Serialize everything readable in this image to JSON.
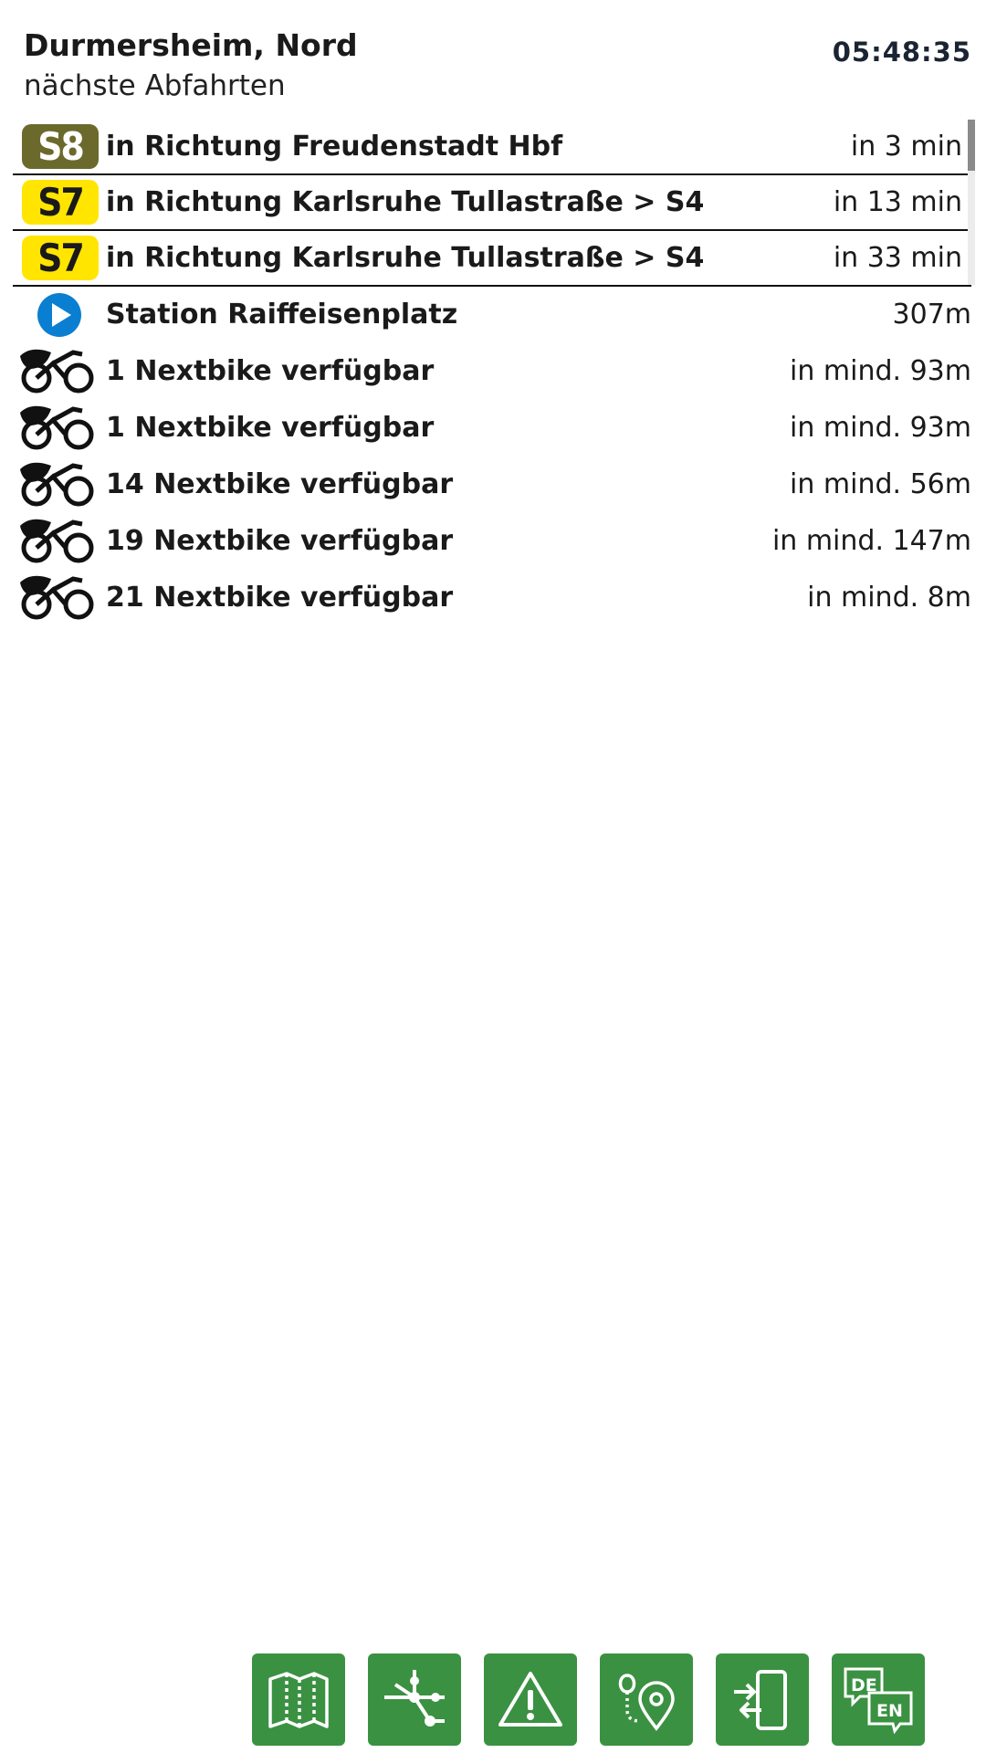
{
  "header": {
    "stop_name": "Durmersheim, Nord",
    "subtitle": "nächste Abfahrten",
    "clock": "05:48:35"
  },
  "departures": [
    {
      "line": "S8",
      "line_color": "#6b6a2c",
      "text_color": "#ffffff",
      "direction": "in Richtung Freudenstadt Hbf",
      "time": "in 3 min"
    },
    {
      "line": "S7",
      "line_color": "#ffe500",
      "text_color": "#1a1a1a",
      "direction": "in Richtung Karlsruhe Tullastraße > S4",
      "time": "in 13 min"
    },
    {
      "line": "S7",
      "line_color": "#ffe500",
      "text_color": "#1a1a1a",
      "direction": "in Richtung Karlsruhe Tullastraße > S4",
      "time": "in 33 min"
    }
  ],
  "pois": [
    {
      "icon": "play-circle-icon",
      "label": "Station Raiffeisenplatz",
      "distance": "307m"
    },
    {
      "icon": "nextbike-icon",
      "label": "1 Nextbike verfügbar",
      "distance": "in mind. 93m"
    },
    {
      "icon": "nextbike-icon",
      "label": "1 Nextbike verfügbar",
      "distance": "in mind. 93m"
    },
    {
      "icon": "nextbike-icon",
      "label": "14 Nextbike verfügbar",
      "distance": "in mind. 56m"
    },
    {
      "icon": "nextbike-icon",
      "label": "19 Nextbike verfügbar",
      "distance": "in mind. 147m"
    },
    {
      "icon": "nextbike-icon",
      "label": "21 Nextbike verfügbar",
      "distance": "in mind. 8m"
    }
  ],
  "toolbar": {
    "buttons": [
      "map-icon",
      "network-icon",
      "warning-icon",
      "route-pin-icon",
      "transfer-phone-icon",
      "language-icon"
    ],
    "language_from": "DE",
    "language_to": "EN"
  },
  "colors": {
    "toolbar_green": "#3b9142",
    "station_blue": "#0a7fd1",
    "s8": "#6b6a2c",
    "s7": "#ffe500"
  }
}
